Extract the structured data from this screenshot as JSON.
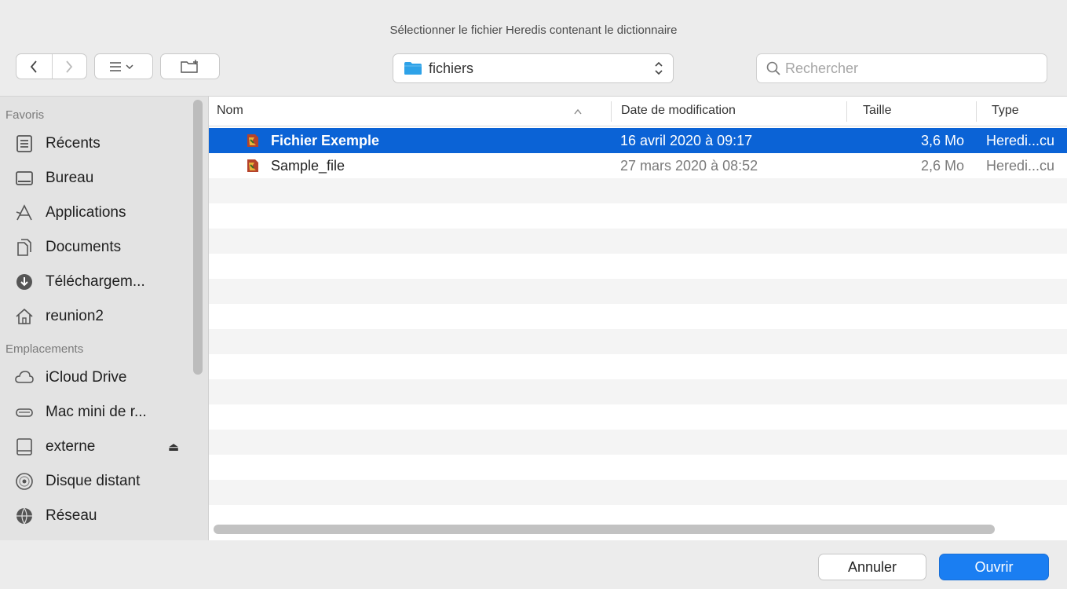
{
  "dialog": {
    "title": "Sélectionner le fichier Heredis contenant le dictionnaire"
  },
  "toolbar": {
    "back_icon": "chevron-left-icon",
    "forward_icon": "chevron-right-icon",
    "view_icon": "list-view-icon",
    "new_folder_icon": "new-folder-icon",
    "location": "fichiers",
    "search_placeholder": "Rechercher"
  },
  "sidebar": {
    "favorites_header": "Favoris",
    "favorites": [
      {
        "label": "Récents",
        "icon": "recents-icon"
      },
      {
        "label": "Bureau",
        "icon": "desktop-icon"
      },
      {
        "label": "Applications",
        "icon": "applications-icon"
      },
      {
        "label": "Documents",
        "icon": "documents-icon"
      },
      {
        "label": "Téléchargem...",
        "icon": "downloads-icon"
      },
      {
        "label": "reunion2",
        "icon": "home-icon"
      }
    ],
    "locations_header": "Emplacements",
    "locations": [
      {
        "label": "iCloud Drive",
        "icon": "cloud-icon"
      },
      {
        "label": "Mac mini de r...",
        "icon": "hard-drive-icon"
      },
      {
        "label": "externe",
        "icon": "external-drive-icon",
        "eject": "⏏"
      },
      {
        "label": "Disque distant",
        "icon": "remote-disc-icon"
      },
      {
        "label": "Réseau",
        "icon": "network-icon"
      }
    ]
  },
  "file_list": {
    "columns": {
      "name": "Nom",
      "date": "Date de modification",
      "size": "Taille",
      "type": "Type"
    },
    "rows": [
      {
        "name": "Fichier Exemple",
        "date": "16 avril 2020 à 09:17",
        "size": "3,6 Mo",
        "type": "Heredi...cu",
        "selected": true
      },
      {
        "name": "Sample_file",
        "date": "27 mars 2020 à 08:52",
        "size": "2,6 Mo",
        "type": "Heredi...cu",
        "selected": false
      }
    ]
  },
  "footer": {
    "cancel_label": "Annuler",
    "open_label": "Ouvrir"
  },
  "colors": {
    "selection": "#0b63d6",
    "primary_button": "#1a7ef2",
    "folder": "#2ea2e8"
  }
}
